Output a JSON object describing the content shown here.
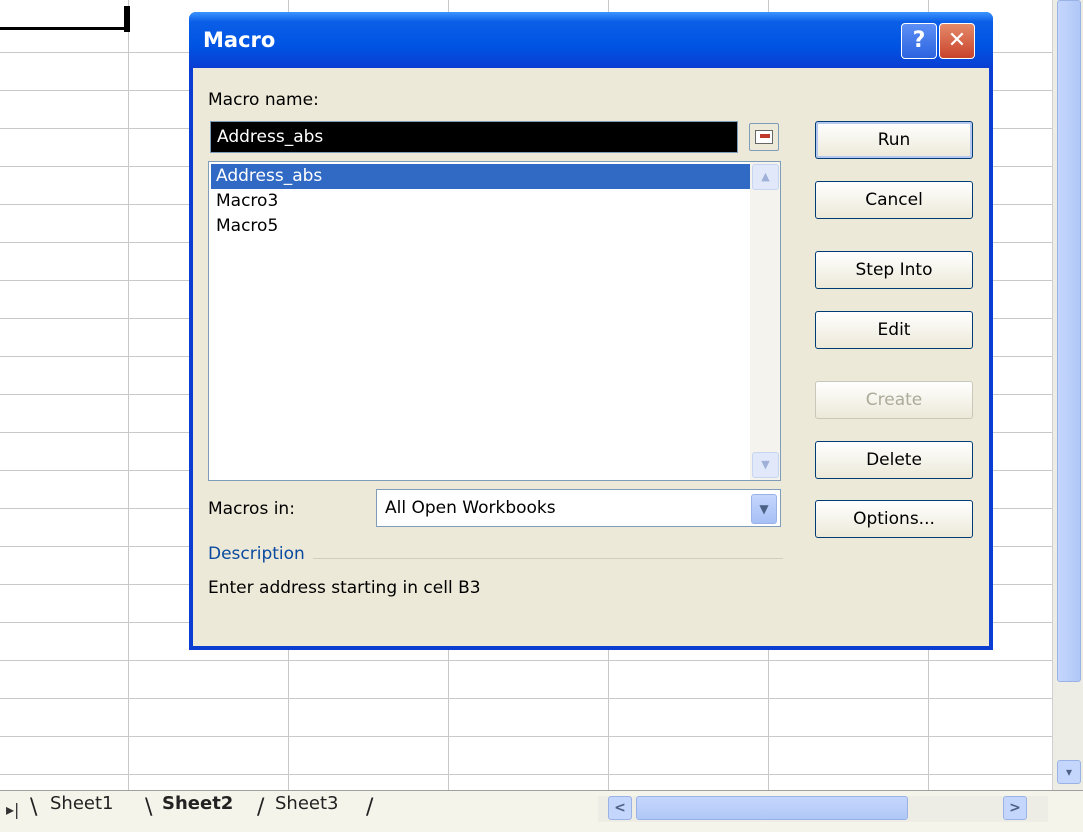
{
  "sheet_tabs": {
    "nav": "▸|",
    "tabs": [
      {
        "label": "Sheet1"
      },
      {
        "label": "Sheet2"
      },
      {
        "label": "Sheet3"
      }
    ]
  },
  "scroll": {
    "left_arrow": "<",
    "right_arrow": ">",
    "down_arrow": "▾"
  },
  "dialog": {
    "title": "Macro",
    "help_button": "?",
    "close_button": "✕",
    "macro_name_label": "Macro name:",
    "macro_name_value": "Address_abs",
    "macro_list": [
      "Address_abs",
      "Macro3",
      "Macro5"
    ],
    "selected_index": 0,
    "macros_in_label": "Macros in:",
    "macros_in_value": "All Open Workbooks",
    "description_label": "Description",
    "description_text": "Enter address starting in cell B3",
    "buttons": {
      "run": "Run",
      "cancel": "Cancel",
      "step_into": "Step Into",
      "edit": "Edit",
      "create": "Create",
      "delete": "Delete",
      "options": "Options..."
    },
    "colors": {
      "title_bar": "#0054e3",
      "selection": "#316ac5",
      "description_label": "#0a4aa0"
    }
  }
}
